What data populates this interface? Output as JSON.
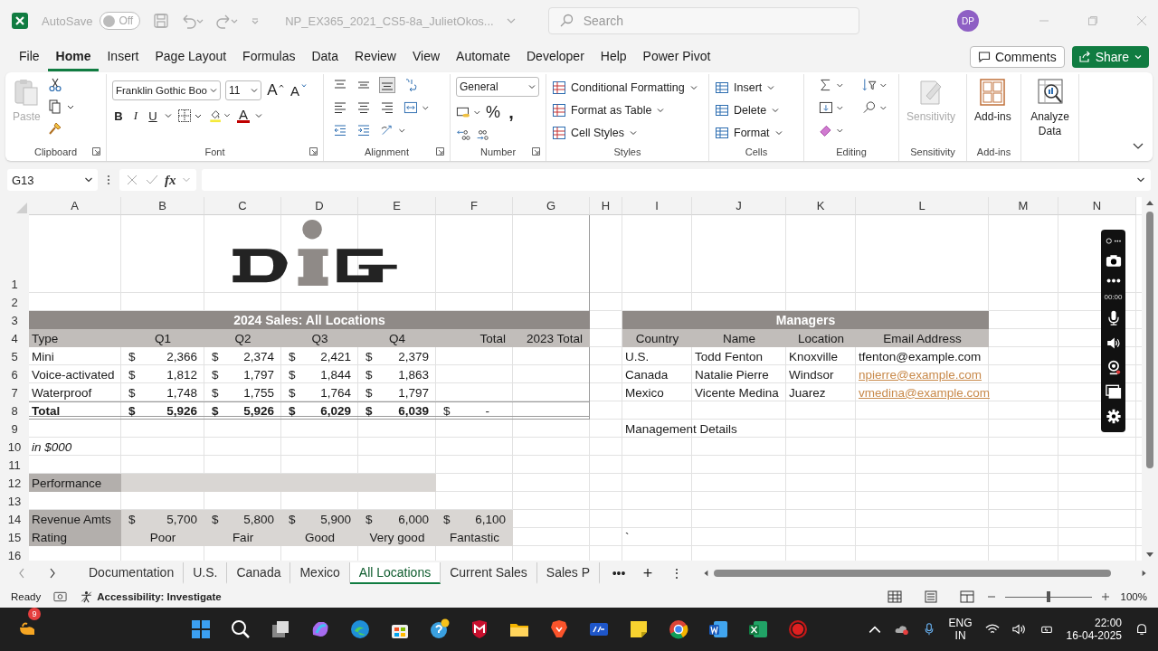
{
  "title_bar": {
    "autosave": "AutoSave",
    "autosave_toggle": {
      "label": "Off",
      "on": false
    },
    "file_name": "NP_EX365_2021_CS5-8a_JulietOkos...",
    "search": {
      "placeholder": "Search"
    },
    "avatar": "DP"
  },
  "menu": [
    {
      "label": "File",
      "selected": false
    },
    {
      "label": "Home",
      "selected": true
    },
    {
      "label": "Insert",
      "selected": false
    },
    {
      "label": "Page Layout",
      "selected": false
    },
    {
      "label": "Formulas",
      "selected": false
    },
    {
      "label": "Data",
      "selected": false
    },
    {
      "label": "Review",
      "selected": false
    },
    {
      "label": "View",
      "selected": false
    },
    {
      "label": "Automate",
      "selected": false
    },
    {
      "label": "Developer",
      "selected": false
    },
    {
      "label": "Help",
      "selected": false
    },
    {
      "label": "Power Pivot",
      "selected": false
    }
  ],
  "comments": "Comments",
  "share": "Share",
  "ribbon": {
    "clipboard": {
      "paste": {
        "label": "Paste",
        "disabled": true
      },
      "label": "Clipboard"
    },
    "font": {
      "name": "Franklin Gothic Boo",
      "size": "11",
      "grow": "A",
      "shrink": "A",
      "bold": "B",
      "italic": "I",
      "underline": "U",
      "color_letter": "A",
      "label": "Font"
    },
    "alignment": {
      "label": "Alignment"
    },
    "number": {
      "format": "General",
      "percent": "%",
      "comma": ",",
      "label": "Number"
    },
    "styles": {
      "items": [
        "Conditional Formatting",
        "Format as Table",
        "Cell Styles"
      ],
      "label": "Styles"
    },
    "cells": {
      "items": [
        "Insert",
        "Delete",
        "Format"
      ],
      "label": "Cells"
    },
    "editing": {
      "label": "Editing"
    },
    "sensitivity": {
      "button": "Sensitivity",
      "disabled": true,
      "label": "Sensitivity"
    },
    "addins": {
      "button": "Add-ins",
      "label": "Add-ins"
    },
    "analyze": {
      "button": "Analyze Data"
    }
  },
  "formula_bar": {
    "name_box": "G13",
    "fx": "fx"
  },
  "columns": [
    "A",
    "B",
    "C",
    "D",
    "E",
    "F",
    "G",
    "H",
    "I",
    "J",
    "K",
    "L",
    "M",
    "N"
  ],
  "rows": [
    "1",
    "2",
    "3",
    "4",
    "5",
    "6",
    "7",
    "8",
    "9",
    "10",
    "11",
    "12",
    "13",
    "14",
    "15",
    "16"
  ],
  "sales_table": {
    "title": "2024 Sales: All Locations",
    "columns": [
      "Type",
      "Q1",
      "Q2",
      "Q3",
      "Q4",
      "Total",
      "2023 Total"
    ],
    "rows": [
      {
        "type": "Mini",
        "values": [
          {
            "currency": "$",
            "amount": "2,366"
          },
          {
            "currency": "$",
            "amount": "2,374"
          },
          {
            "currency": "$",
            "amount": "2,421"
          },
          {
            "currency": "$",
            "amount": "2,379"
          }
        ]
      },
      {
        "type": "Voice-activated",
        "values": [
          {
            "currency": "$",
            "amount": "1,812"
          },
          {
            "currency": "$",
            "amount": "1,797"
          },
          {
            "currency": "$",
            "amount": "1,844"
          },
          {
            "currency": "$",
            "amount": "1,863"
          }
        ]
      },
      {
        "type": "Waterproof",
        "values": [
          {
            "currency": "$",
            "amount": "1,748"
          },
          {
            "currency": "$",
            "amount": "1,755"
          },
          {
            "currency": "$",
            "amount": "1,764"
          },
          {
            "currency": "$",
            "amount": "1,797"
          }
        ]
      }
    ],
    "total": {
      "label": "Total",
      "values": [
        {
          "currency": "$",
          "amount": "5,926"
        },
        {
          "currency": "$",
          "amount": "5,926"
        },
        {
          "currency": "$",
          "amount": "6,029"
        },
        {
          "currency": "$",
          "amount": "6,039"
        },
        {
          "currency": "$",
          "amount": "-"
        }
      ]
    }
  },
  "note": "in $000",
  "performance": {
    "label": "Performance",
    "rows": [
      {
        "label": "Revenue Amts",
        "values": [
          {
            "currency": "$",
            "amount": "5,700"
          },
          {
            "currency": "$",
            "amount": "5,800"
          },
          {
            "currency": "$",
            "amount": "5,900"
          },
          {
            "currency": "$",
            "amount": "6,000"
          },
          {
            "currency": "$",
            "amount": "6,100"
          }
        ]
      },
      {
        "label": "Rating",
        "values": [
          {
            "amount": "Poor"
          },
          {
            "amount": "Fair"
          },
          {
            "amount": "Good"
          },
          {
            "amount": "Very good"
          },
          {
            "amount": "Fantastic"
          }
        ]
      }
    ]
  },
  "managers": {
    "title": "Managers",
    "columns": [
      "Country",
      "Name",
      "Location",
      "Email Address"
    ],
    "rows": [
      {
        "country": "U.S.",
        "name": "Todd Fenton",
        "location": "Knoxville",
        "email": "tfenton@example.com",
        "hyperlink": false
      },
      {
        "country": "Canada",
        "name": "Natalie Pierre",
        "location": "Windsor",
        "email": "npierre@example.com",
        "hyperlink": true
      },
      {
        "country": "Mexico",
        "name": "Vicente Medina",
        "location": "Juarez",
        "email": "vmedina@example.com",
        "hyperlink": true
      }
    ]
  },
  "management_details": "Management Details",
  "stray_mark": "`",
  "recorder": {
    "timer": "00:00"
  },
  "sheet_tabs": [
    {
      "label": "Documentation",
      "selected": false
    },
    {
      "label": "U.S.",
      "selected": false
    },
    {
      "label": "Canada",
      "selected": false
    },
    {
      "label": "Mexico",
      "selected": false
    },
    {
      "label": "All Locations",
      "selected": true
    },
    {
      "label": "Current Sales",
      "selected": false
    },
    {
      "label": "Sales P",
      "selected": false
    }
  ],
  "sheet_controls": {
    "more": "•••",
    "add": "+",
    "menu": "⋮"
  },
  "status_bar": {
    "ready": "Ready",
    "accessibility": "Accessibility: Investigate",
    "zoom": {
      "reading": "100%",
      "level": 0.5
    }
  },
  "taskbar": {
    "badge": "9",
    "language": [
      "ENG",
      "IN"
    ],
    "time": "22:00",
    "date": "16-04-2025"
  }
}
